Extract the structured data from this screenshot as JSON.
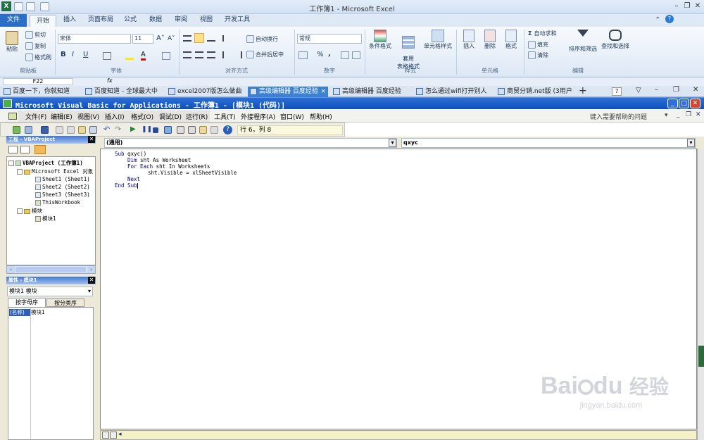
{
  "excel": {
    "title": "工作簿1 - Microsoft Excel",
    "tabs": [
      "文件",
      "开始",
      "插入",
      "页面布局",
      "公式",
      "数据",
      "审阅",
      "视图",
      "开发工具"
    ],
    "active_tab": "开始",
    "clipboard": {
      "paste": "粘贴",
      "cut": "剪切",
      "copy": "复制",
      "format_painter": "格式刷",
      "label": "剪贴板"
    },
    "font": {
      "name": "宋体",
      "size": "11",
      "bold": "B",
      "italic": "I",
      "underline": "U",
      "label": "字体"
    },
    "alignment": {
      "wrap": "自动换行",
      "merge": "合并后居中",
      "label": "对齐方式"
    },
    "number": {
      "format": "常规",
      "percent": "%",
      "comma": ",",
      "label": "数字"
    },
    "styles": {
      "cond": "条件格式",
      "table": "套用\n表格格式",
      "cell": "单元格样式",
      "label": "样式"
    },
    "cells": {
      "insert": "插入",
      "delete": "删除",
      "format": "格式",
      "label": "单元格"
    },
    "editing": {
      "autosum": "自动求和",
      "fill": "填充",
      "clear": "清除",
      "sort": "排序和筛选",
      "find": "查找和选择",
      "label": "编辑"
    },
    "namebox": "F22"
  },
  "browser_tabs": [
    {
      "label": "百度一下，你就知道",
      "active": false
    },
    {
      "label": "百度知道 - 全球最大中",
      "active": false
    },
    {
      "label": "excel2007版怎么做曲",
      "active": false
    },
    {
      "label": "高级编辑器 百度经验",
      "active": true
    },
    {
      "label": "高级编辑器 百度经验",
      "active": false
    },
    {
      "label": "怎么通过wifi打开别人",
      "active": false
    },
    {
      "label": "商贸分销.net版 (3用户",
      "active": false
    }
  ],
  "browser_count": "7",
  "vbe": {
    "title": "Microsoft Visual Basic for Applications - 工作簿1 - [模块1 (代码)]",
    "menu": [
      "文件(F)",
      "编辑(E)",
      "视图(V)",
      "插入(I)",
      "格式(O)",
      "调试(D)",
      "运行(R)",
      "工具(T)",
      "外接程序(A)",
      "窗口(W)",
      "帮助(H)"
    ],
    "help_placeholder": "键入需要帮助的问题",
    "linecol": "行 6，列 8",
    "project_title": "工程 - VBAProject",
    "tree": {
      "root": "VBAProject (工作簿1)",
      "excel_objects": "Microsoft Excel 对象",
      "sheet1": "Sheet1 (Sheet1)",
      "sheet2": "Sheet2 (Sheet2)",
      "sheet3": "Sheet3 (Sheet3)",
      "workbook": "ThisWorkbook",
      "modules": "模块",
      "module1": "模块1"
    },
    "props_title": "属性 - 模块1",
    "props_object": "模块1 模块",
    "props_tabs": [
      "按字母序",
      "按分类序"
    ],
    "props_row": {
      "key": "(名称)",
      "value": "模块1"
    },
    "object_combo": "(通用)",
    "proc_combo": "qxyc",
    "code": [
      {
        "indent": 0,
        "kw": "Sub",
        "rest": " qxyc()"
      },
      {
        "indent": 1,
        "kw": "Dim",
        "rest": " sht As Worksheet"
      },
      {
        "indent": 1,
        "kw": "For Each",
        "rest": " sht In Worksheets"
      },
      {
        "indent": 2,
        "kw": "",
        "rest": "sht.Visible = xlSheetVisible"
      },
      {
        "indent": 1,
        "kw": "Next",
        "rest": ""
      },
      {
        "indent": 0,
        "kw": "End Sub",
        "rest": ""
      }
    ]
  },
  "watermark": {
    "brand": "Bai",
    "brand2": "du",
    "cn": "经验",
    "url": "jingyan.baidu.com"
  }
}
